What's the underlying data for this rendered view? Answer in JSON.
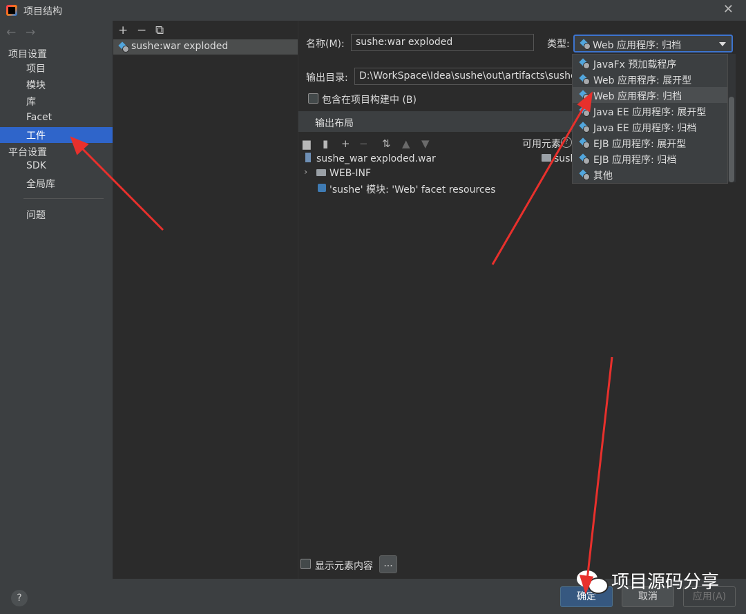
{
  "window": {
    "title": "项目结构",
    "close_glyph": "✕"
  },
  "nav": {
    "back_glyph": "←",
    "forward_glyph": "→",
    "project_settings": "项目设置",
    "project_items": [
      "项目",
      "模块",
      "库",
      "Facet",
      "工件"
    ],
    "platform_settings": "平台设置",
    "platform_items": [
      "SDK",
      "全局库"
    ],
    "problems": "问题"
  },
  "artifacts": {
    "toolbar": {
      "add": "+",
      "remove": "−",
      "copy": "⧉"
    },
    "items": [
      "sushe:war exploded"
    ]
  },
  "form": {
    "name_label": "名称(M):",
    "name_value": "sushe:war exploded",
    "type_label": "类型:",
    "type_value": "Web 应用程序: 归档",
    "output_dir_label": "输出目录:",
    "output_dir_value": "D:\\WorkSpace\\Idea\\sushe\\out\\artifacts\\sushe_w",
    "include_in_build_label": "包含在项目构建中 (B)",
    "output_layout_label": "输出布局",
    "available_elements_label": "可用元素",
    "available_partial": "sush",
    "show_contents_label": "显示元素内容",
    "ellipsis_label": "..."
  },
  "tree": {
    "root": "sushe_war exploded.war",
    "child1": "WEB-INF",
    "child2": "'sushe' 模块: 'Web' facet resources"
  },
  "type_options": [
    "JavaFx 预加载程序",
    "Web 应用程序: 展开型",
    "Web 应用程序: 归档",
    "Java EE 应用程序: 展开型",
    "Java EE 应用程序: 归档",
    "EJB 应用程序: 展开型",
    "EJB 应用程序: 归档",
    "其他"
  ],
  "buttons": {
    "ok": "确定",
    "cancel": "取消",
    "apply": "应用(A)",
    "help": "?"
  },
  "watermark": "项目源码分享",
  "colors": {
    "accent": "#2f65ca",
    "annotation": "#e8302c",
    "primary_button": "#365880"
  }
}
